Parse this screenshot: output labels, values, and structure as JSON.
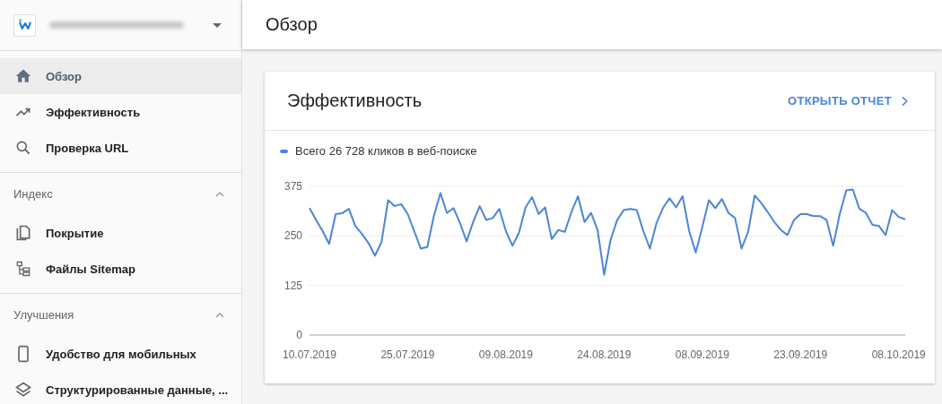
{
  "sidebar": {
    "property_selector": {
      "expanded": false
    },
    "items": [
      {
        "kind": "link",
        "label": "Обзор",
        "selected": true
      },
      {
        "kind": "link",
        "label": "Эффективность",
        "selected": false
      },
      {
        "kind": "link",
        "label": "Проверка URL",
        "selected": false
      },
      {
        "kind": "section",
        "label": "Индекс",
        "expanded": true
      },
      {
        "kind": "link",
        "label": "Покрытие",
        "selected": false
      },
      {
        "kind": "link",
        "label": "Файлы Sitemap",
        "selected": false
      },
      {
        "kind": "section",
        "label": "Улучшения",
        "expanded": true
      },
      {
        "kind": "link",
        "label": "Удобство для мобильных",
        "selected": false
      },
      {
        "kind": "link",
        "label": "Структурированные данные, ...",
        "selected": false
      }
    ]
  },
  "page_title": "Обзор",
  "card": {
    "title": "Эффективность",
    "action": "ОТКРЫТЬ ОТЧЕТ",
    "chart_data": {
      "type": "line",
      "series": [
        {
          "name": "Всего 26 728 кликов в веб-поиске",
          "color": "#4a86d8",
          "values": [
            320,
            290,
            262,
            230,
            305,
            307,
            318,
            275,
            255,
            232,
            200,
            235,
            340,
            325,
            330,
            305,
            262,
            218,
            222,
            300,
            358,
            308,
            320,
            282,
            236,
            285,
            325,
            290,
            295,
            318,
            262,
            225,
            258,
            322,
            348,
            305,
            322,
            242,
            265,
            260,
            310,
            350,
            285,
            308,
            265,
            152,
            240,
            290,
            315,
            318,
            315,
            262,
            218,
            282,
            320,
            345,
            322,
            350,
            262,
            208,
            272,
            340,
            320,
            343,
            308,
            295,
            218,
            260,
            352,
            333,
            310,
            285,
            265,
            252,
            290,
            305,
            305,
            300,
            300,
            290,
            225,
            305,
            365,
            367,
            318,
            308,
            278,
            275,
            252,
            315,
            298,
            292
          ]
        }
      ],
      "categories": [
        "10.07.2019",
        null,
        null,
        null,
        null,
        null,
        null,
        null,
        null,
        null,
        null,
        null,
        null,
        null,
        null,
        "25.07.2019",
        null,
        null,
        null,
        null,
        null,
        null,
        null,
        null,
        null,
        null,
        null,
        null,
        null,
        null,
        "09.08.2019",
        null,
        null,
        null,
        null,
        null,
        null,
        null,
        null,
        null,
        null,
        null,
        null,
        null,
        null,
        "24.08.2019",
        null,
        null,
        null,
        null,
        null,
        null,
        null,
        null,
        null,
        null,
        null,
        null,
        null,
        null,
        "08.09.2019",
        null,
        null,
        null,
        null,
        null,
        null,
        null,
        null,
        null,
        null,
        null,
        null,
        null,
        null,
        "23.09.2019",
        null,
        null,
        null,
        null,
        null,
        null,
        null,
        null,
        null,
        null,
        null,
        null,
        null,
        null,
        "08.10.2019",
        null
      ],
      "ylim": [
        0,
        375
      ],
      "yticks": [
        0,
        125,
        250,
        375
      ]
    }
  }
}
